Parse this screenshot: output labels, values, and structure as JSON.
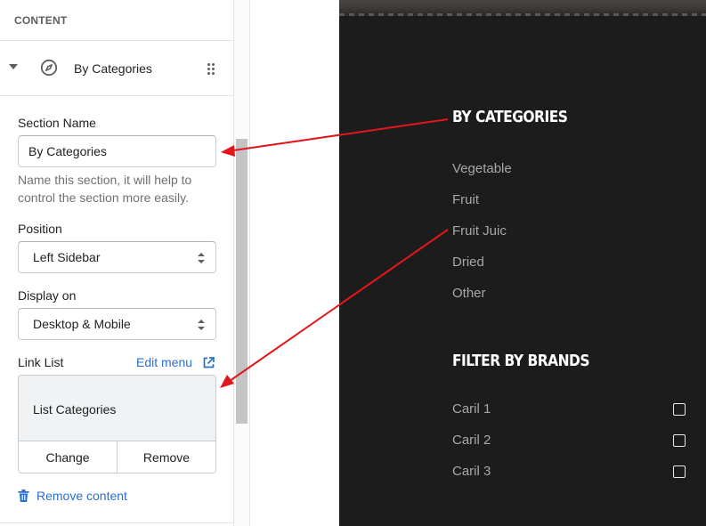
{
  "panel": {
    "header": "CONTENT",
    "section_title": "By Categories",
    "fields": {
      "section_name_label": "Section Name",
      "section_name_value": "By Categories",
      "section_name_help": "Name this section, it will help to control the section more easily.",
      "position_label": "Position",
      "position_value": "Left Sidebar",
      "display_label": "Display on",
      "display_value": "Desktop & Mobile",
      "link_list_label": "Link List",
      "edit_menu": "Edit menu",
      "link_list_value": "List Categories",
      "change": "Change",
      "remove": "Remove"
    },
    "remove_content": "Remove content"
  },
  "preview": {
    "categories_heading": "BY CATEGORIES",
    "categories": [
      "Vegetable",
      "Fruit",
      "Fruit Juic",
      "Dried",
      "Other"
    ],
    "brands_heading": "FILTER BY BRANDS",
    "brands": [
      "Caril 1",
      "Caril 2",
      "Caril 3"
    ]
  },
  "colors": {
    "accent_link": "#2c6ecb",
    "annotation_arrow": "#e3161b",
    "preview_bg": "#1c1c1c"
  }
}
